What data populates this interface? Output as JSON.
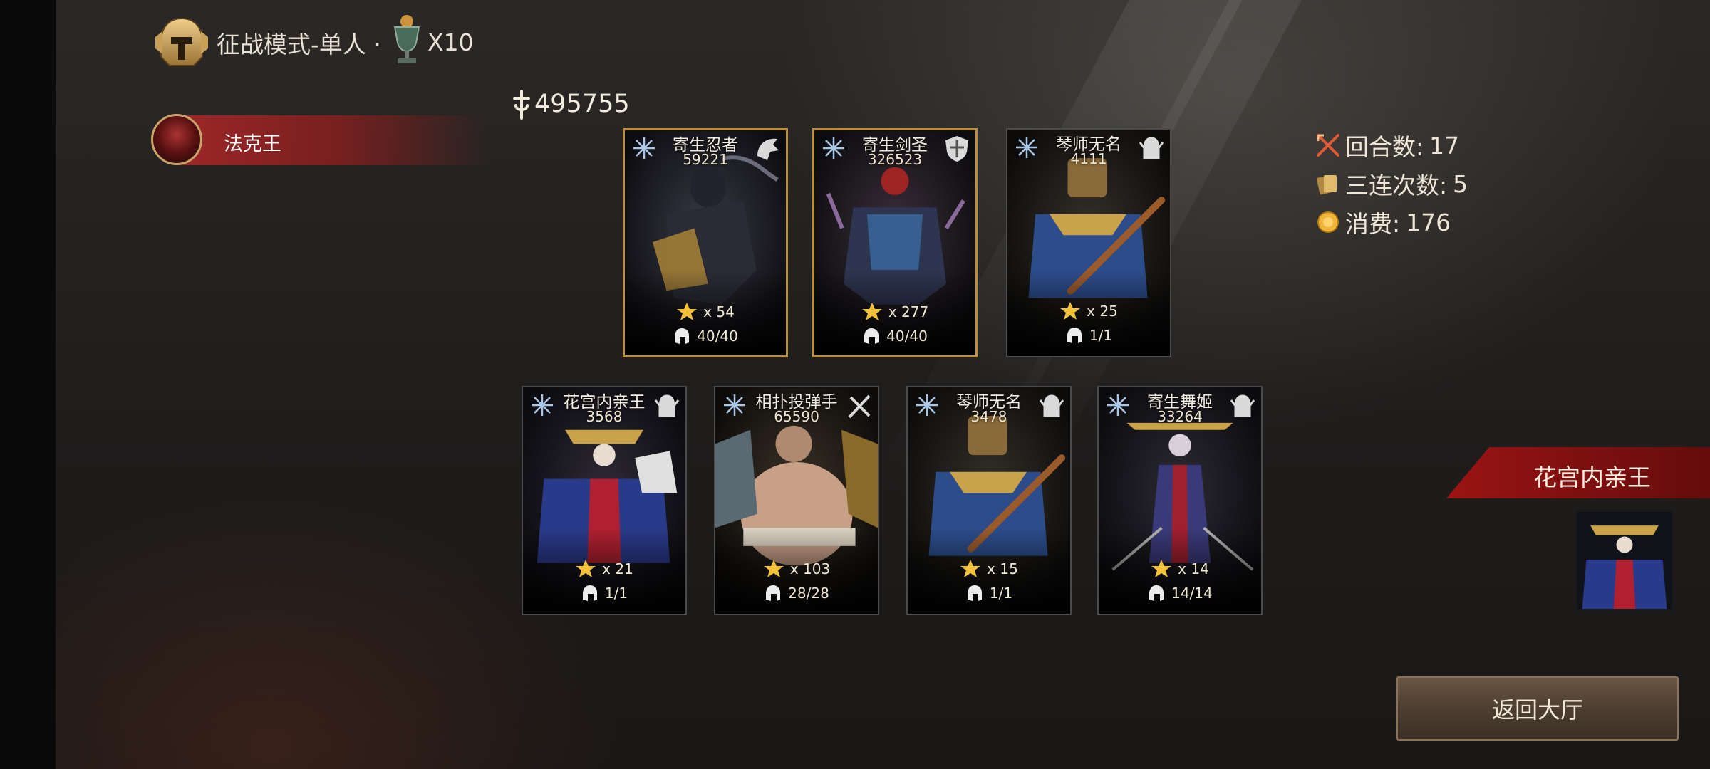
{
  "header": {
    "mode_text": "征战模式-单人 ·",
    "multiplier": "X10",
    "mode_icon": "helmet-icon",
    "trophy_icon": "trophy-icon"
  },
  "player": {
    "name": "法克王",
    "avatar_icon": "demon-mask-avatar"
  },
  "total_power": "495755",
  "stats": {
    "rounds_label": "回合数:",
    "rounds_value": "17",
    "triples_label": "三连次数:",
    "triples_value": "5",
    "cost_label": "消费:",
    "cost_value": "176"
  },
  "cards": [
    {
      "name": "寄生忍者",
      "power": "59221",
      "stars": "x 54",
      "capacity": "40/40",
      "gold": true,
      "class_icon": "beast-head-icon"
    },
    {
      "name": "寄生剑圣",
      "power": "326523",
      "stars": "x 277",
      "capacity": "40/40",
      "gold": true,
      "class_icon": "shield-icon"
    },
    {
      "name": "琴师无名",
      "power": "4111",
      "stars": "x 25",
      "capacity": "1/1",
      "gold": false,
      "class_icon": "winged-helm-icon"
    },
    {
      "name": "花宫内亲王",
      "power": "3568",
      "stars": "x 21",
      "capacity": "1/1",
      "gold": false,
      "class_icon": "winged-helm-icon"
    },
    {
      "name": "相扑投弹手",
      "power": "65590",
      "stars": "x 103",
      "capacity": "28/28",
      "gold": false,
      "class_icon": "crossed-weapons-icon"
    },
    {
      "name": "琴师无名",
      "power": "3478",
      "stars": "x 15",
      "capacity": "1/1",
      "gold": false,
      "class_icon": "winged-helm-icon"
    },
    {
      "name": "寄生舞姬",
      "power": "33264",
      "stars": "x 14",
      "capacity": "14/14",
      "gold": false,
      "class_icon": "winged-helm-icon"
    }
  ],
  "featured": {
    "name": "花宫内亲王"
  },
  "buttons": {
    "return_label": "返回大厅"
  },
  "colors": {
    "accent_red": "#9a1414",
    "gold_border": "#b8903a",
    "button_brown": "#4d3e31"
  }
}
